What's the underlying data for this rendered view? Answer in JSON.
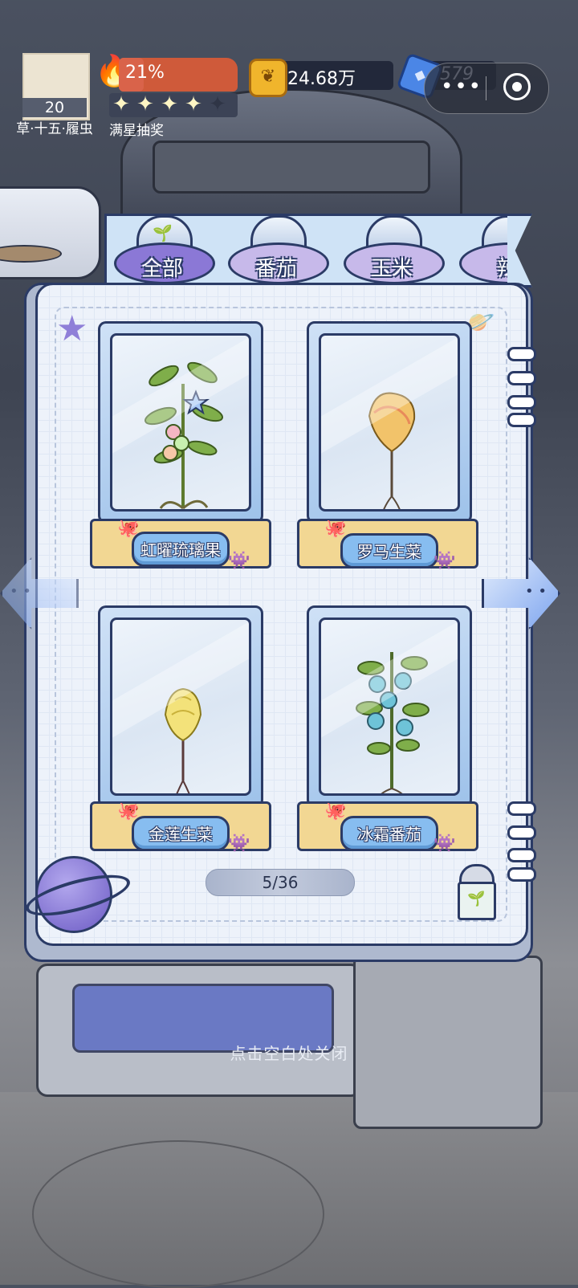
{
  "player": {
    "level": "20",
    "rank": "草·十五·履虫",
    "progress_percent_label": "21%",
    "progress_fraction": 0.21,
    "stars_filled": 4,
    "stars_total": 5,
    "stars_label": "满星抽奖"
  },
  "currency": {
    "coins": "24.68万",
    "coin_icon": "coin-sprout-icon",
    "gems": "579",
    "gem_icon": "blue-crystal-icon"
  },
  "tabs": [
    {
      "label": "全部",
      "active": true
    },
    {
      "label": "番茄",
      "active": false
    },
    {
      "label": "玉米",
      "active": false
    },
    {
      "label": "辣",
      "active": false
    }
  ],
  "cards": [
    {
      "name": "虹曜琉璃果"
    },
    {
      "name": "罗马生菜"
    },
    {
      "name": "金莲生菜"
    },
    {
      "name": "冰霜番茄"
    }
  ],
  "pager": {
    "label": "5/36"
  },
  "close_hint": "点击空白处关闭",
  "colors": {
    "accent_blue": "#87bdf0",
    "outline": "#2b3b66",
    "progress": "#cf5a3a",
    "coin": "#f0b52c"
  }
}
